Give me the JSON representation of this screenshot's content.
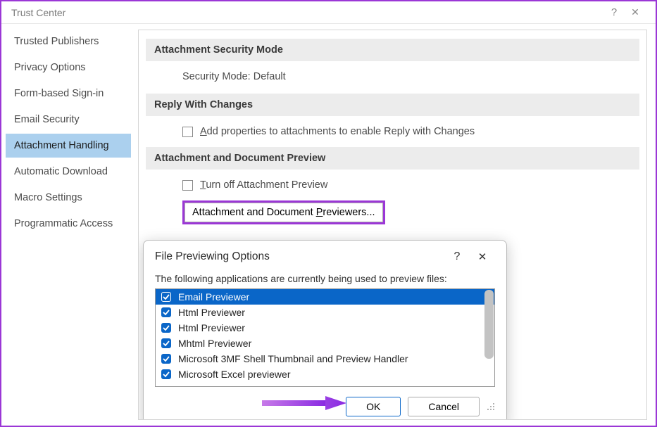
{
  "window": {
    "title": "Trust Center",
    "help": "?",
    "close": "✕"
  },
  "sidebar": {
    "items": [
      "Trusted Publishers",
      "Privacy Options",
      "Form-based Sign-in",
      "Email Security",
      "Attachment Handling",
      "Automatic Download",
      "Macro Settings",
      "Programmatic Access"
    ],
    "selectedIndex": 4
  },
  "content": {
    "section1": {
      "header": "Attachment Security Mode",
      "text": "Security Mode: Default"
    },
    "section2": {
      "header": "Reply With Changes",
      "checkboxLabel": "Add properties to attachments to enable Reply with Changes"
    },
    "section3": {
      "header": "Attachment and Document Preview",
      "checkboxLabel": "Turn off Attachment Preview",
      "buttonLabel": "Attachment and Document Previewers..."
    }
  },
  "dialog": {
    "title": "File Previewing Options",
    "help": "?",
    "close": "✕",
    "instruction": "The following applications are currently being used to preview files:",
    "items": [
      {
        "label": "Email Previewer",
        "checked": true,
        "selected": true
      },
      {
        "label": "Html Previewer",
        "checked": true,
        "selected": false
      },
      {
        "label": "Html Previewer",
        "checked": true,
        "selected": false
      },
      {
        "label": "Mhtml Previewer",
        "checked": true,
        "selected": false
      },
      {
        "label": "Microsoft 3MF Shell Thumbnail and Preview Handler",
        "checked": true,
        "selected": false
      },
      {
        "label": "Microsoft Excel previewer",
        "checked": true,
        "selected": false
      }
    ],
    "okLabel": "OK",
    "cancelLabel": "Cancel"
  }
}
